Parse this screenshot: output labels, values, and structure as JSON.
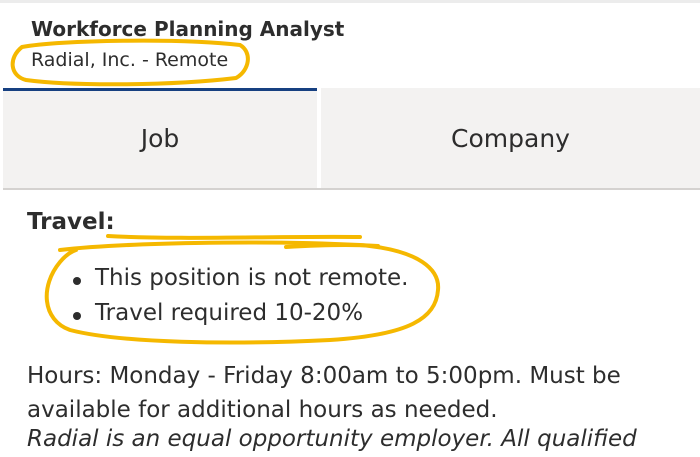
{
  "header": {
    "job_title": "Workforce Planning Analyst",
    "company_location": "Radial, Inc. - Remote"
  },
  "tabs": [
    {
      "label": "Job",
      "active": true
    },
    {
      "label": "Company",
      "active": false
    }
  ],
  "section": {
    "heading": "Travel:",
    "bullets": [
      "This position is not remote.",
      "Travel required 10-20%"
    ]
  },
  "hours_text": "Hours: Monday - Friday 8:00am to 5:00pm. Must be available for additional hours as needed.",
  "eeo_text": "Radial is an equal opportunity employer. All qualified",
  "colors": {
    "accent": "#164081",
    "tab_bg": "#f3f2f1",
    "highlight_marker": "#f5b800",
    "text": "#2d2d2d"
  }
}
